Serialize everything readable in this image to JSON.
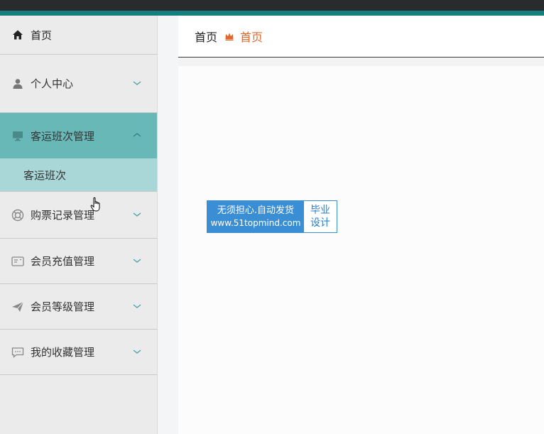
{
  "sidebar": {
    "home": {
      "label": "首页",
      "icon": "home-icon"
    },
    "items": [
      {
        "label": "个人中心",
        "icon": "user-icon"
      },
      {
        "label": "客运班次管理",
        "icon": "monitor-icon",
        "expanded": true,
        "children": [
          {
            "label": "客运班次"
          }
        ]
      },
      {
        "label": "购票记录管理",
        "icon": "lifebuoy-icon"
      },
      {
        "label": "会员充值管理",
        "icon": "card-icon"
      },
      {
        "label": "会员等级管理",
        "icon": "paper-plane-icon"
      },
      {
        "label": "我的收藏管理",
        "icon": "chat-icon"
      }
    ]
  },
  "breadcrumb": {
    "home": "首页",
    "current": "首页"
  },
  "watermark": {
    "line1": "无须担心.自动发货",
    "line2": "www.51topmind.com",
    "right_line1": "毕业",
    "right_line2": "设计"
  },
  "colors": {
    "accent_teal": "#68b8b8",
    "submenu_teal": "#a9d6d6",
    "breadcrumb_orange": "#e0662a",
    "watermark_blue": "#3a8fd4"
  }
}
